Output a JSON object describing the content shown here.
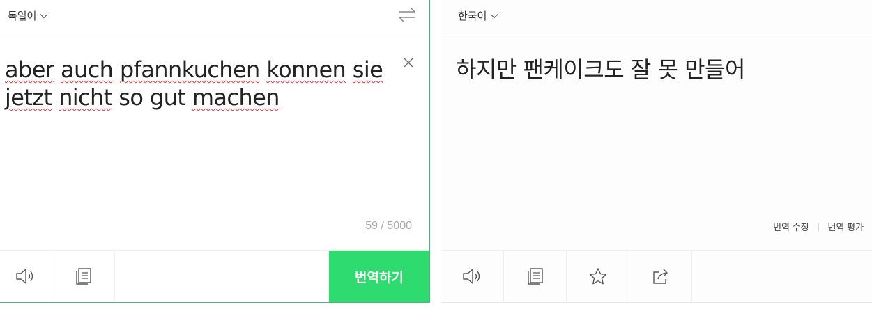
{
  "source": {
    "language": "독일어",
    "words": [
      {
        "text": "aber",
        "misspelled": true
      },
      {
        "text": "auch",
        "misspelled": true
      },
      {
        "text": "pfannkuchen",
        "misspelled": true
      },
      {
        "text": "konnen",
        "misspelled": true
      },
      {
        "text": "sie",
        "misspelled": true
      },
      {
        "text": "jetzt",
        "misspelled": true
      },
      {
        "text": "nicht",
        "misspelled": true
      },
      {
        "text": "so",
        "misspelled": false
      },
      {
        "text": "gut",
        "misspelled": false
      },
      {
        "text": "machen",
        "misspelled": true
      }
    ],
    "counter": "59 / 5000",
    "translate_button": "번역하기"
  },
  "target": {
    "language": "한국어",
    "text": "하지만 팬케이크도 잘 못 만들어",
    "edit_link": "번역 수정",
    "rate_link": "번역 평가"
  },
  "colors": {
    "accent_green": "#2edb6f",
    "panel_border_green": "#2fc46e",
    "spell_error": "#e6303b"
  },
  "icons": {
    "source_toolbar": [
      "speaker-icon",
      "copy-icon"
    ],
    "target_toolbar": [
      "speaker-icon",
      "copy-icon",
      "star-icon",
      "share-icon"
    ]
  }
}
